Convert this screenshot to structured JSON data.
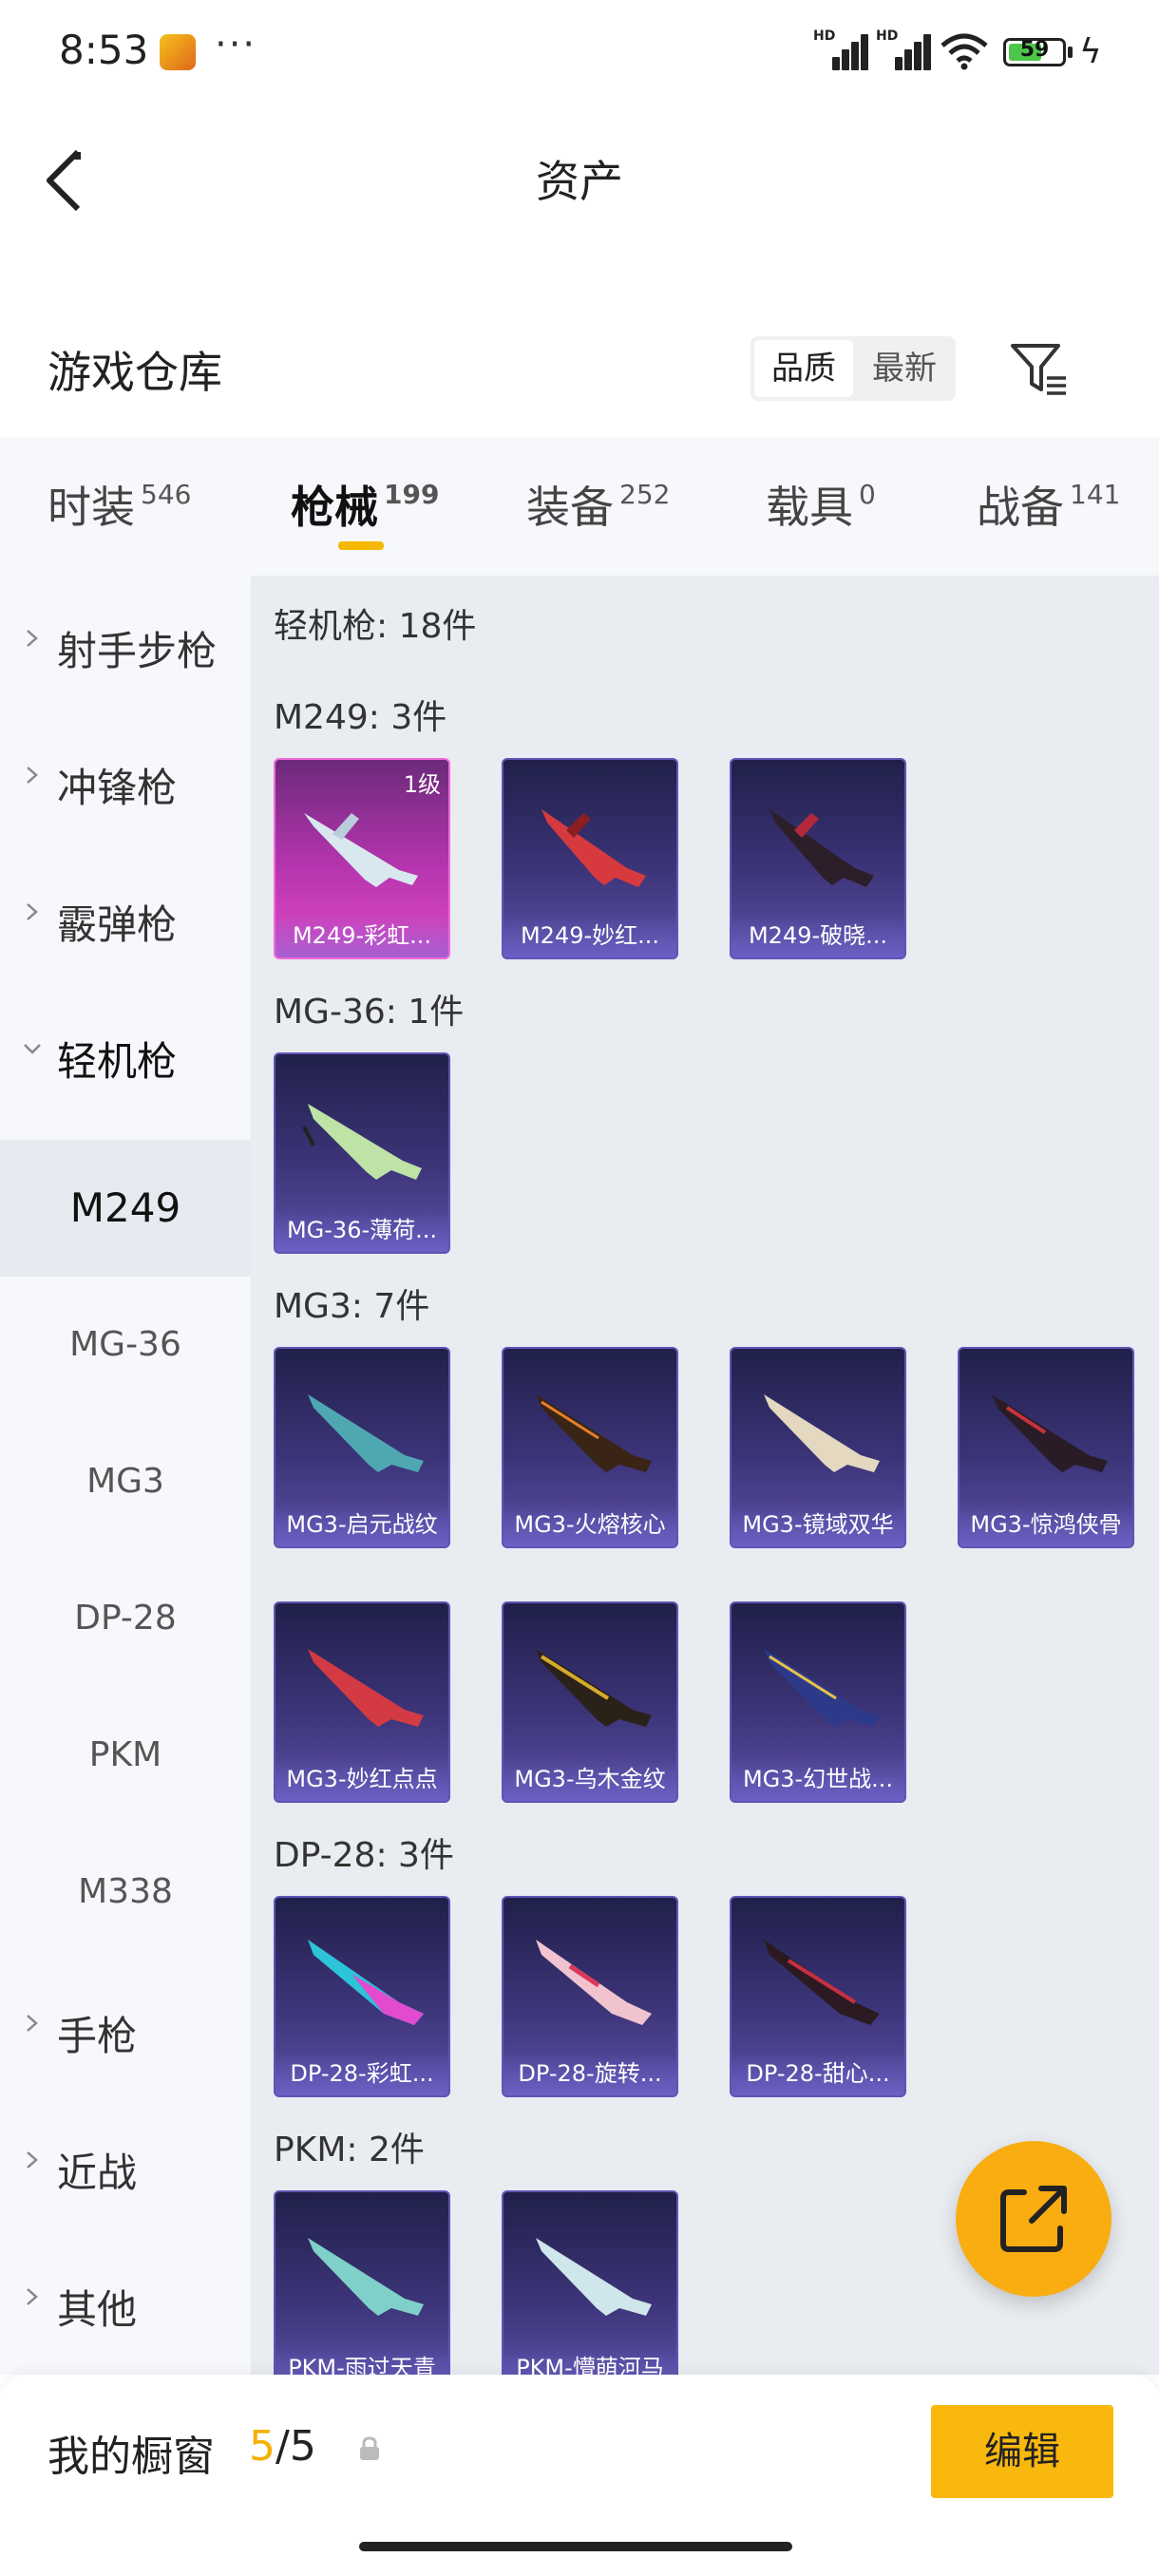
{
  "status_bar": {
    "time": "8:53",
    "dots": "···",
    "battery": "59",
    "net1": "HD",
    "net2": "HD"
  },
  "header": {
    "title": "资产"
  },
  "warehouse": {
    "title": "游戏仓库",
    "sort_options": [
      "品质",
      "最新"
    ]
  },
  "tabs": [
    {
      "label": "时装",
      "count": "546"
    },
    {
      "label": "枪械",
      "count": "199"
    },
    {
      "label": "装备",
      "count": "252"
    },
    {
      "label": "载具",
      "count": "0"
    },
    {
      "label": "战备",
      "count": "141"
    }
  ],
  "sidebar": {
    "categories": [
      "射手步枪",
      "冲锋枪",
      "霰弹枪",
      "轻机枪",
      "手枪",
      "近战",
      "其他"
    ],
    "sub_items": [
      "M249",
      "MG-36",
      "MG3",
      "DP-28",
      "PKM",
      "M338"
    ]
  },
  "content": {
    "category_label": "轻机枪: 18件",
    "groups": [
      {
        "label": "M249: 3件",
        "items": [
          {
            "name": "M249-彩虹...",
            "level": "1级"
          },
          {
            "name": "M249-妙红..."
          },
          {
            "name": "M249-破晓..."
          }
        ]
      },
      {
        "label": "MG-36: 1件",
        "items": [
          {
            "name": "MG-36-薄荷..."
          }
        ]
      },
      {
        "label": "MG3: 7件",
        "items": [
          {
            "name": "MG3-启元战纹"
          },
          {
            "name": "MG3-火熔核心"
          },
          {
            "name": "MG3-镜域双华"
          },
          {
            "name": "MG3-惊鸿侠骨"
          },
          {
            "name": "MG3-妙红点点"
          },
          {
            "name": "MG3-乌木金纹"
          },
          {
            "name": "MG3-幻世战..."
          }
        ]
      },
      {
        "label": "DP-28: 3件",
        "items": [
          {
            "name": "DP-28-彩虹..."
          },
          {
            "name": "DP-28-旋转..."
          },
          {
            "name": "DP-28-甜心..."
          }
        ]
      },
      {
        "label": "PKM: 2件",
        "items": [
          {
            "name": "PKM-雨过天青"
          },
          {
            "name": "PKM-懵萌河马"
          }
        ]
      }
    ]
  },
  "bottom_bar": {
    "label": "我的橱窗",
    "count_current": "5",
    "count_sep": "/5",
    "edit_label": "编辑"
  },
  "colors": {
    "accent": "#f9b80e",
    "card_bg": "#3c3478",
    "card_pink": "#c23cb6"
  }
}
